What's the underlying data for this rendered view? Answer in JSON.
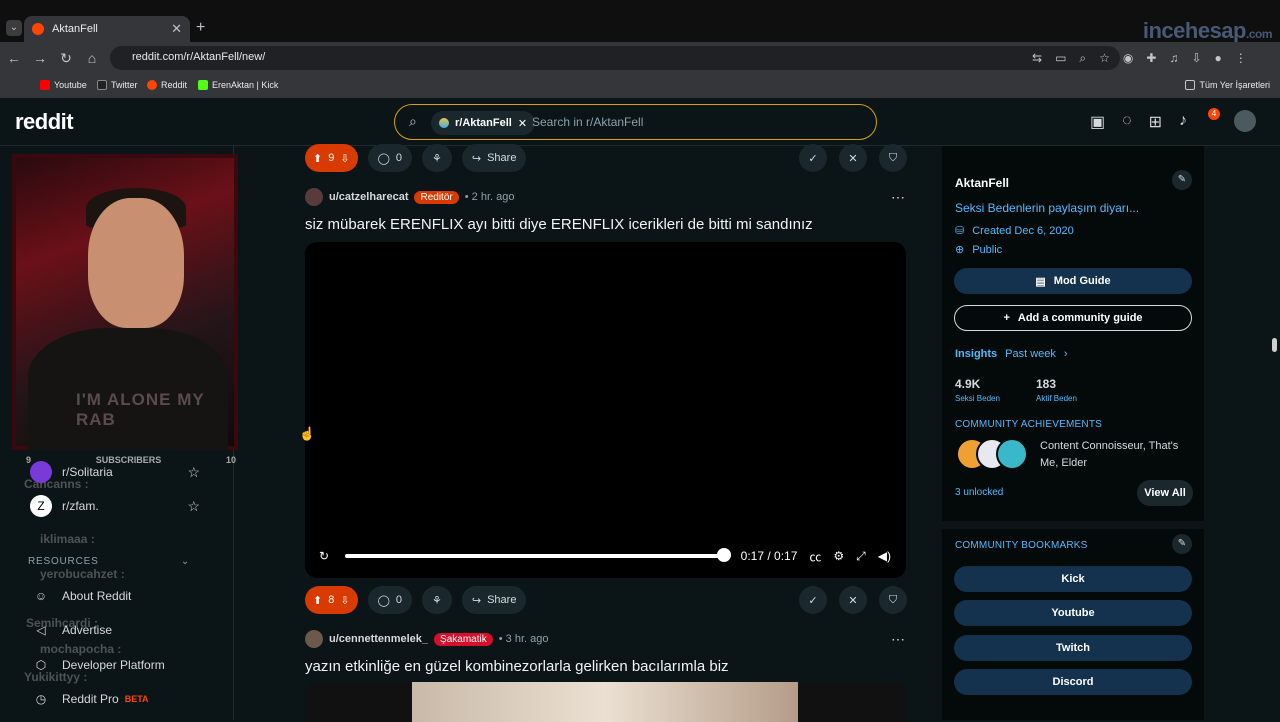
{
  "browser": {
    "tab_title": "AktanFell",
    "url": "reddit.com/r/AktanFell/new/",
    "bookmarks": [
      "Youtube",
      "Twitter",
      "Reddit",
      "ErenAktan | Kick"
    ],
    "all_bookmarks": "Tüm Yer İşaretleri",
    "watermark": "incehesap",
    "watermark_tld": ".com"
  },
  "header": {
    "logo": "reddit",
    "search_chip": "r/AktanFell",
    "search_placeholder": "Search in r/AktanFell",
    "notification_count": "4"
  },
  "left_nav": {
    "webcam_caption": "I'M ALONE MY RAB",
    "subscribers_label": "SUBSCRIBERS",
    "subscribers_left": "9",
    "subscribers_right": "10",
    "communities": [
      {
        "name": "r/Solitaria"
      },
      {
        "name": "r/zfam."
      }
    ],
    "resources_label": "RESOURCES",
    "items": [
      "About Reddit",
      "Advertise",
      "Developer Platform",
      "Reddit Pro"
    ],
    "beta_label": "BETA",
    "chat_names": [
      "Cancanns :",
      "Semihcardi :",
      "iklimaaa :",
      "yerobucahzet :",
      "mochapocha :",
      "Yukikittyy :"
    ]
  },
  "posts": [
    {
      "upvotes": "9",
      "comments": "0",
      "share_label": "Share"
    },
    {
      "user": "u/catzelharecat",
      "flair": "Reditör",
      "flair_color": "#d93a00",
      "time": "2 hr. ago",
      "title": "siz mübarek ERENFLIX ayı bitti diye ERENFLIX icerikleri de bitti mi sandınız",
      "video_time": "0:17 / 0:17",
      "upvotes": "8",
      "comments": "0",
      "share_label": "Share"
    },
    {
      "user": "u/cennettenmelek_",
      "flair": "Şakamatik",
      "flair_color": "#d4102b",
      "time": "3 hr. ago",
      "title": "yazın etkinliğe en güzel kombinezorlarla gelirken bacılarımla biz"
    }
  ],
  "sidebar": {
    "title": "AktanFell",
    "description": "Seksi Bedenlerin paylaşım diyarı...",
    "created": "Created Dec 6, 2020",
    "visibility": "Public",
    "mod_guide": "Mod Guide",
    "add_guide": "Add a community guide",
    "insights_label": "Insights",
    "insights_range": "Past week",
    "members_count": "4.9K",
    "members_label": "Seksi Beden",
    "online_count": "183",
    "online_label": "Aktif Beden",
    "achievements_heading": "COMMUNITY ACHIEVEMENTS",
    "achievements_text": "Content Connoisseur, That's Me, Elder",
    "unlocked": "3 unlocked",
    "view_all": "View All",
    "bookmarks_heading": "COMMUNITY BOOKMARKS",
    "bookmark_buttons": [
      "Kick",
      "Youtube",
      "Twitch",
      "Discord"
    ]
  },
  "colors": {
    "accent": "#ff4500",
    "upvote_bg": "#d93a00",
    "sidebar_button": "#14324d",
    "link_blue": "#4fbcff"
  }
}
